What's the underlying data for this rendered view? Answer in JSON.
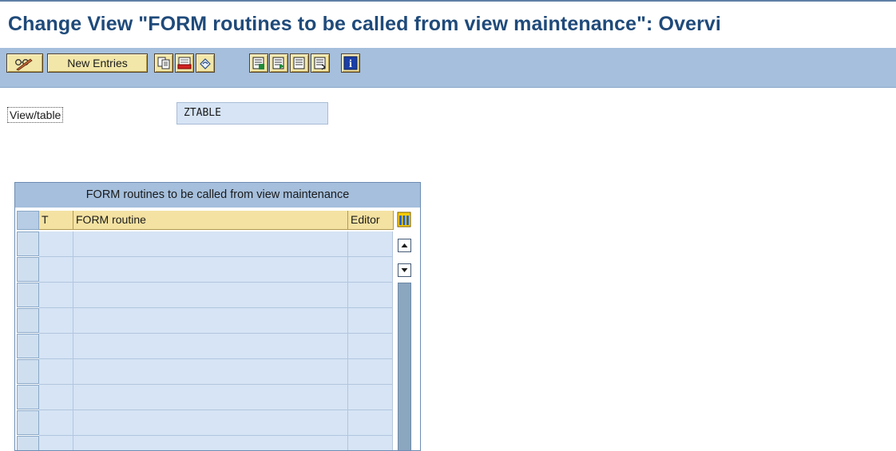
{
  "window": {
    "title": "Change View \"FORM routines to be called from view maintenance\": Overvi"
  },
  "toolbar": {
    "new_entries_label": "New Entries",
    "icons": [
      "display-change-icon",
      "copy-icon",
      "delete-icon",
      "undo-change-icon",
      "select-all-icon",
      "select-block-icon",
      "deselect-all-icon",
      "info-icon"
    ]
  },
  "header_fields": {
    "view_table_label": "View/table",
    "view_table_value": "ZTABLE"
  },
  "table": {
    "title": "FORM routines to be called from view maintenance",
    "columns": [
      "T",
      "FORM routine",
      "Editor"
    ],
    "rows": [
      [
        "",
        "",
        ""
      ],
      [
        "",
        "",
        ""
      ],
      [
        "",
        "",
        ""
      ],
      [
        "",
        "",
        ""
      ],
      [
        "",
        "",
        ""
      ],
      [
        "",
        "",
        ""
      ],
      [
        "",
        "",
        ""
      ],
      [
        "",
        "",
        ""
      ],
      [
        "",
        "",
        ""
      ]
    ]
  },
  "colors": {
    "title_text": "#1f4a7a",
    "toolbar_bg": "#a5bfdc",
    "input_bg": "#d6e4f5",
    "header_bg": "#f4e2a2"
  }
}
